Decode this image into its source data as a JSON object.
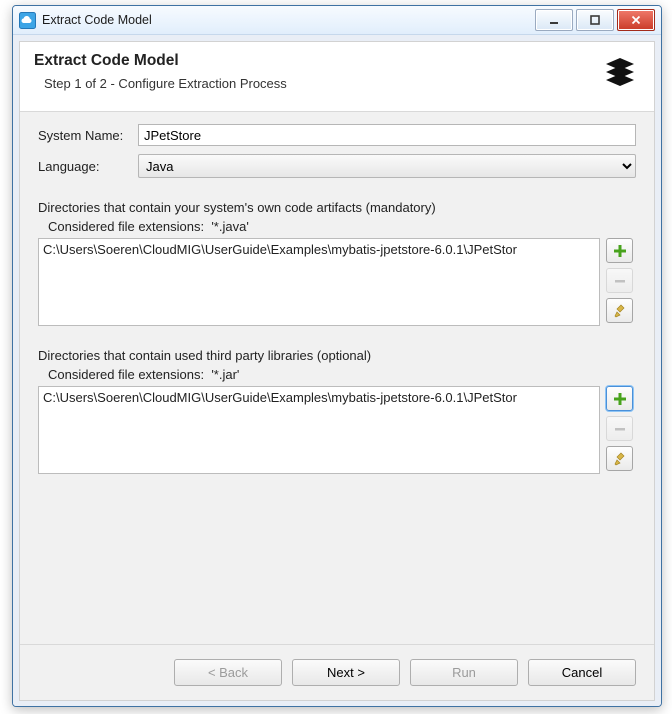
{
  "window": {
    "title": "Extract Code Model"
  },
  "header": {
    "title": "Extract Code Model",
    "subtitle": "Step 1 of 2 - Configure Extraction Process"
  },
  "form": {
    "systemNameLabel": "System Name:",
    "systemNameValue": "JPetStore",
    "languageLabel": "Language:",
    "languageValue": "Java"
  },
  "section1": {
    "title": "Directories that contain your system's own code artifacts (mandatory)",
    "extLabel": "Considered file extensions:",
    "extValue": "'*.java'",
    "items": [
      "C:\\Users\\Soeren\\CloudMIG\\UserGuide\\Examples\\mybatis-jpetstore-6.0.1\\JPetStor"
    ]
  },
  "section2": {
    "title": "Directories that contain used third party libraries (optional)",
    "extLabel": "Considered file extensions:",
    "extValue": "'*.jar'",
    "items": [
      "C:\\Users\\Soeren\\CloudMIG\\UserGuide\\Examples\\mybatis-jpetstore-6.0.1\\JPetStor"
    ]
  },
  "footer": {
    "back": "< Back",
    "next": "Next >",
    "run": "Run",
    "cancel": "Cancel"
  }
}
